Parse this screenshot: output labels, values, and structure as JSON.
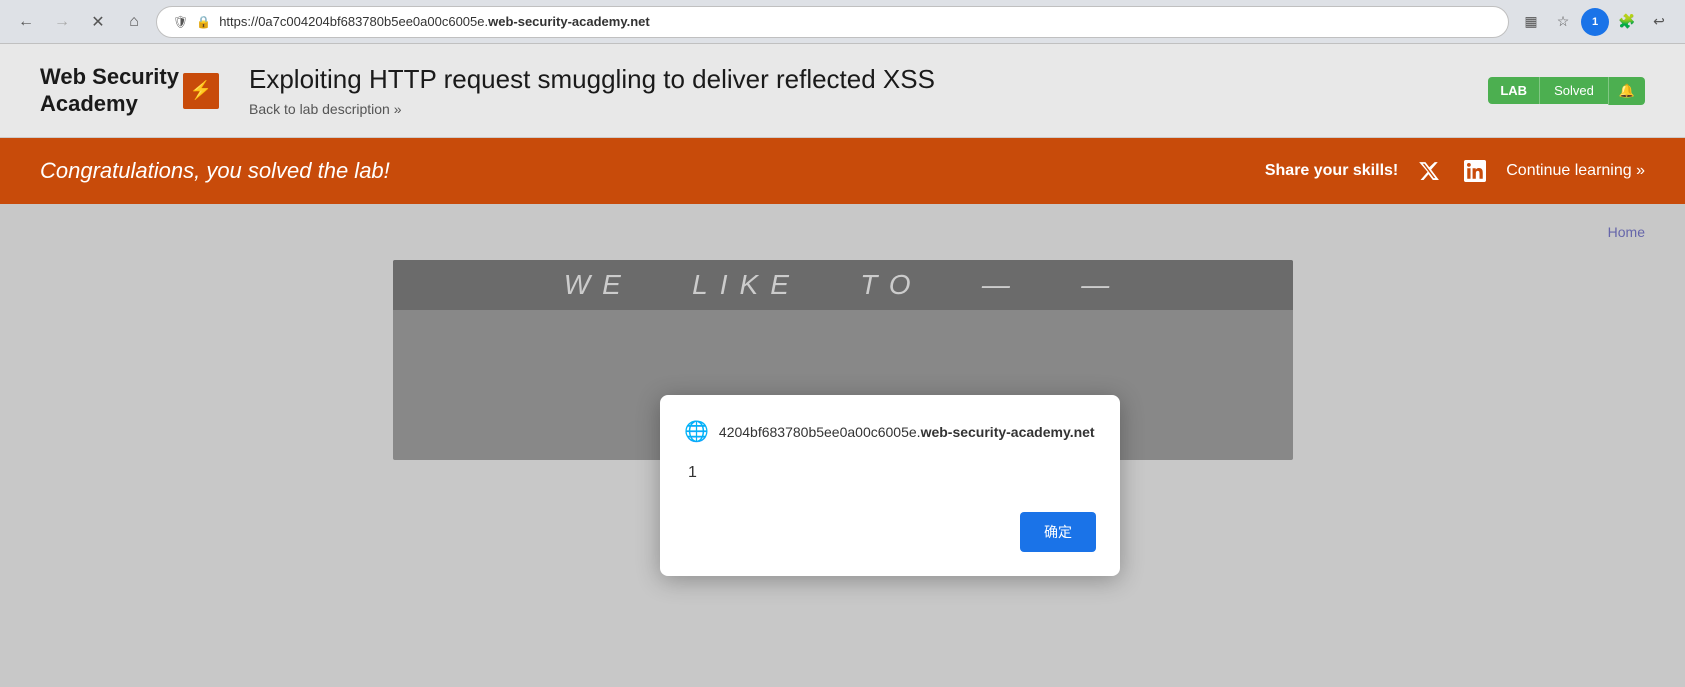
{
  "browser": {
    "url_prefix": "https://0a7c004204bf683780b5ee0a00c6005e.",
    "url_domain": "web-security-academy.net",
    "back_disabled": false,
    "forward_disabled": true
  },
  "header": {
    "logo_line1": "Web Security",
    "logo_line2": "Academy",
    "logo_icon": "⚡",
    "lab_title": "Exploiting HTTP request smuggling to deliver reflected XSS",
    "back_link": "Back to lab description »",
    "badge_lab": "LAB",
    "badge_solved": "Solved",
    "badge_bell": "🔔"
  },
  "banner": {
    "congrats_text": "Congratulations, you solved the lab!",
    "share_label": "Share your skills!",
    "twitter_icon": "𝕏",
    "linkedin_icon": "in",
    "continue_label": "Continue learning »"
  },
  "content": {
    "home_link": "Home",
    "website_title": "WE LIKE TO —  —"
  },
  "dialog": {
    "globe_icon": "🌐",
    "domain_prefix": "4204bf683780b5ee0a00c6005e.",
    "domain_suffix": "web-security-academy.net",
    "message": "1",
    "ok_button": "确定"
  }
}
